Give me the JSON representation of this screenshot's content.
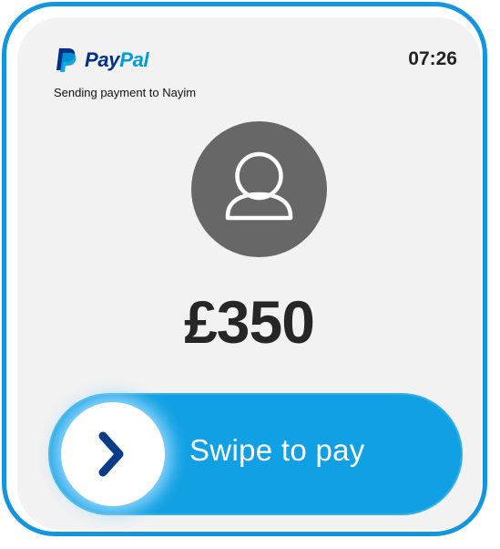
{
  "header": {
    "brand_part1": "Pay",
    "brand_part2": "Pal",
    "time": "07:26",
    "subtitle": "Sending payment to Nayim"
  },
  "payment": {
    "amount": "£350",
    "avatar_icon": "user-icon"
  },
  "swipe": {
    "label": "Swipe to pay",
    "knob_icon": "chevron-right-icon"
  },
  "colors": {
    "frame": "#1296e0",
    "screen_bg": "#f2f2f2",
    "brand_dark": "#003087",
    "brand_light": "#009cde",
    "swipe_bar": "#10a0e3",
    "avatar_bg": "#676767",
    "chevron": "#0b3c8a"
  }
}
